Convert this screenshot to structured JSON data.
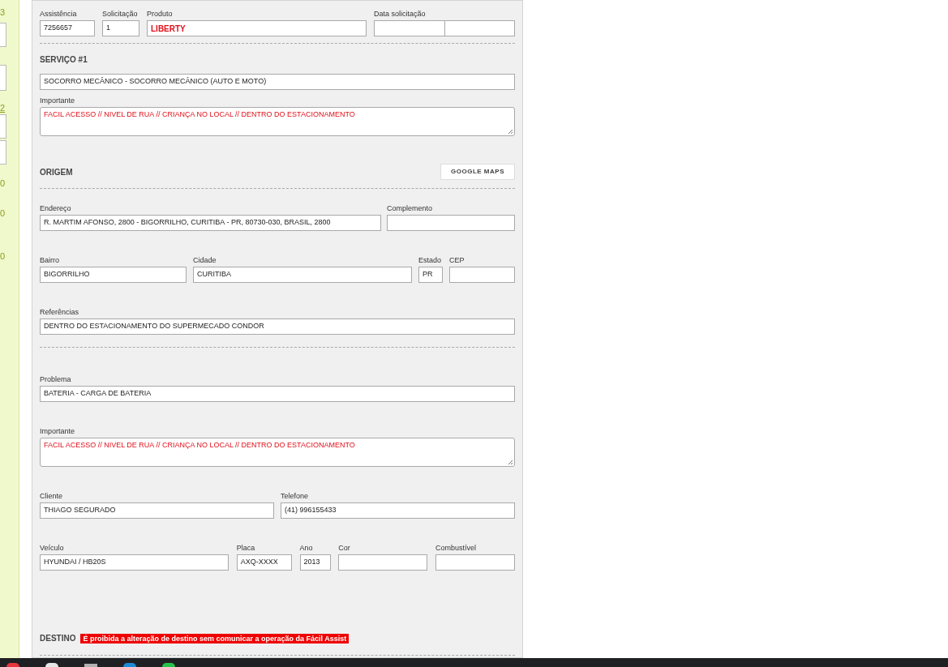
{
  "left_strip": [
    "3",
    "2",
    "0",
    "0",
    "0"
  ],
  "header_fields": [
    {
      "label": "Assistência",
      "value": "7256657",
      "kind": "input"
    },
    {
      "label": "Solicitação",
      "value": "1",
      "kind": "input"
    },
    {
      "label": "Produto",
      "value": "LIBERTY",
      "kind": "input",
      "color": "#e0101a"
    },
    {
      "label": "Data solicitação",
      "kind": "split"
    }
  ],
  "service": {
    "title": "SERVIÇO #1",
    "name_value": "SOCORRO MECÂNICO - SOCORRO MECÂNICO (AUTO E MOTO)",
    "important": {
      "label": "Importante",
      "value": "FACIL ACESSO // NIVEL DE RUA // CRIANÇA NO LOCAL // DENTRO DO ESTACIONAMENTO",
      "kind": "textarea",
      "color": "#e0101a"
    }
  },
  "origin": {
    "title": "ORIGEM",
    "button": "GOOGLE MAPS",
    "fields": [
      {
        "label": "Endereço",
        "value": "R. MARTIM AFONSO, 2800 - BIGORRILHO, CURITIBA - PR, 80730-030, BRASIL, 2800",
        "kind": "input"
      },
      {
        "label": "Complemento",
        "kind": "input"
      },
      {
        "label": "Bairro",
        "value": "BIGORRILHO",
        "kind": "input"
      },
      {
        "label": "Cidade",
        "value": "CURITIBA",
        "kind": "input"
      },
      {
        "label": "Estado",
        "value": "PR",
        "kind": "input"
      },
      {
        "label": "CEP",
        "kind": "input"
      },
      {
        "label": "Referências",
        "value": "DENTRO DO ESTACIONAMENTO DO SUPERMECADO CONDOR",
        "kind": "input"
      }
    ]
  },
  "problem": {
    "fields": [
      {
        "label": "Problema",
        "value": "BATERIA - CARGA DE BATERIA",
        "kind": "input"
      },
      {
        "label": "Importante",
        "value": "FACIL ACESSO // NIVEL DE RUA // CRIANÇA NO LOCAL // DENTRO DO ESTACIONAMENTO",
        "kind": "textarea",
        "color": "#e0101a"
      },
      {
        "label": "Cliente",
        "value": "THIAGO SEGURADO",
        "kind": "input"
      },
      {
        "label": "Telefone",
        "value": "(41) 996155433",
        "kind": "input"
      },
      {
        "label": "Veículo",
        "value": "HYUNDAI / HB20S",
        "kind": "input"
      },
      {
        "label": "Placa",
        "value": "AXQ-XXXX",
        "kind": "input"
      },
      {
        "label": "Ano",
        "value": "2013",
        "kind": "input"
      },
      {
        "label": "Cor",
        "kind": "input"
      },
      {
        "label": "Combustível",
        "kind": "input"
      }
    ]
  },
  "destination": {
    "title": "DESTINO",
    "notice": "É proibida a alteração de destino sem comunicar a operação da Fácil Assist"
  }
}
